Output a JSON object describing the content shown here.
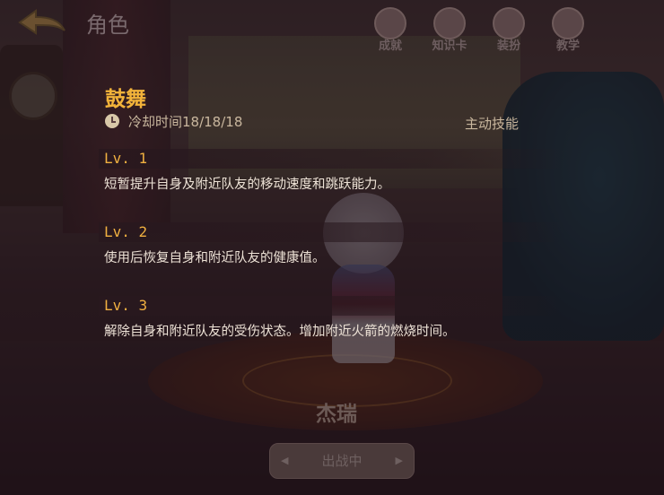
{
  "topbar": {
    "title": "角色",
    "buttons": [
      {
        "label": "成就",
        "icon": "trophy-icon"
      },
      {
        "label": "知识卡",
        "icon": "card-icon"
      },
      {
        "label": "装扮",
        "icon": "outfit-icon"
      },
      {
        "label": "教学",
        "icon": "book-icon"
      }
    ]
  },
  "skill": {
    "name": "鼓舞",
    "cooldown": "冷却时间18/18/18",
    "type": "主动技能",
    "levels": [
      {
        "label": "Lv. 1",
        "desc": "短暂提升自身及附近队友的移动速度和跳跃能力。"
      },
      {
        "label": "Lv. 2",
        "desc": "使用后恢复自身和附近队友的健康值。"
      },
      {
        "label": "Lv. 3",
        "desc": "解除自身和附近队友的受伤状态。增加附近火箭的燃烧时间。"
      }
    ]
  },
  "character": {
    "name": "杰瑞"
  },
  "deploy": {
    "label": "出战中"
  },
  "colors": {
    "accent": "#f2b33a",
    "text": "#ede2d6",
    "muted": "#c9b79e"
  }
}
